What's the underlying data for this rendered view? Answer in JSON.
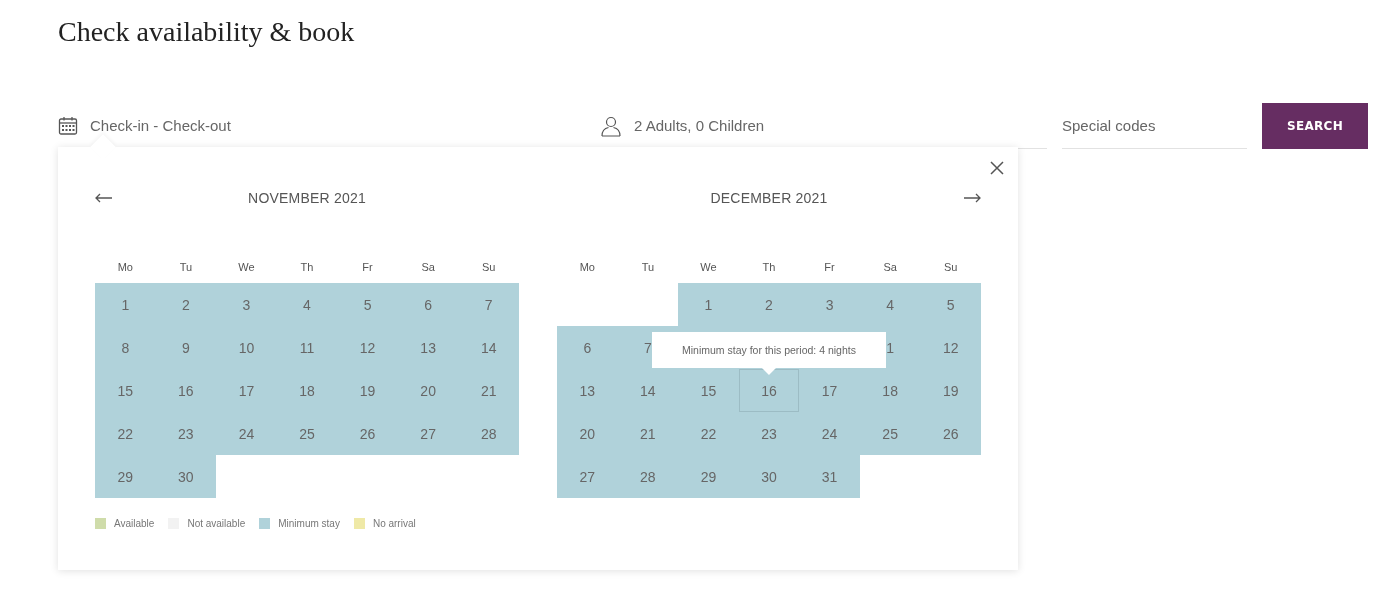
{
  "title": "Check availability & book",
  "search_bar": {
    "dates": {
      "placeholder": "Check-in - Check-out"
    },
    "guests": {
      "value": "2 Adults, 0 Children"
    },
    "special_codes": {
      "placeholder": "Special codes"
    },
    "search_button": "SEARCH"
  },
  "calendar": {
    "months": [
      {
        "title": "NOVEMBER 2021",
        "prev_arrow": true,
        "next_arrow": false,
        "weekdays": [
          "Mo",
          "Tu",
          "We",
          "Th",
          "Fr",
          "Sa",
          "Su"
        ],
        "days": [
          {
            "kind": "minimum_stay",
            "label": "1",
            "hovered": false
          },
          {
            "kind": "minimum_stay",
            "label": "2",
            "hovered": false
          },
          {
            "kind": "minimum_stay",
            "label": "3",
            "hovered": false
          },
          {
            "kind": "minimum_stay",
            "label": "4",
            "hovered": false
          },
          {
            "kind": "minimum_stay",
            "label": "5",
            "hovered": false
          },
          {
            "kind": "minimum_stay",
            "label": "6",
            "hovered": false
          },
          {
            "kind": "minimum_stay",
            "label": "7",
            "hovered": false
          },
          {
            "kind": "minimum_stay",
            "label": "8",
            "hovered": false
          },
          {
            "kind": "minimum_stay",
            "label": "9",
            "hovered": false
          },
          {
            "kind": "minimum_stay",
            "label": "10",
            "hovered": false
          },
          {
            "kind": "minimum_stay",
            "label": "11",
            "hovered": false
          },
          {
            "kind": "minimum_stay",
            "label": "12",
            "hovered": false
          },
          {
            "kind": "minimum_stay",
            "label": "13",
            "hovered": false
          },
          {
            "kind": "minimum_stay",
            "label": "14",
            "hovered": false
          },
          {
            "kind": "minimum_stay",
            "label": "15",
            "hovered": false
          },
          {
            "kind": "minimum_stay",
            "label": "16",
            "hovered": false
          },
          {
            "kind": "minimum_stay",
            "label": "17",
            "hovered": false
          },
          {
            "kind": "minimum_stay",
            "label": "18",
            "hovered": false
          },
          {
            "kind": "minimum_stay",
            "label": "19",
            "hovered": false
          },
          {
            "kind": "minimum_stay",
            "label": "20",
            "hovered": false
          },
          {
            "kind": "minimum_stay",
            "label": "21",
            "hovered": false
          },
          {
            "kind": "minimum_stay",
            "label": "22",
            "hovered": false
          },
          {
            "kind": "minimum_stay",
            "label": "23",
            "hovered": false
          },
          {
            "kind": "minimum_stay",
            "label": "24",
            "hovered": false
          },
          {
            "kind": "minimum_stay",
            "label": "25",
            "hovered": false
          },
          {
            "kind": "minimum_stay",
            "label": "26",
            "hovered": false
          },
          {
            "kind": "minimum_stay",
            "label": "27",
            "hovered": false
          },
          {
            "kind": "minimum_stay",
            "label": "28",
            "hovered": false
          },
          {
            "kind": "minimum_stay",
            "label": "29",
            "hovered": false
          },
          {
            "kind": "minimum_stay",
            "label": "30",
            "hovered": false
          }
        ]
      },
      {
        "title": "DECEMBER 2021",
        "prev_arrow": false,
        "next_arrow": true,
        "weekdays": [
          "Mo",
          "Tu",
          "We",
          "Th",
          "Fr",
          "Sa",
          "Su"
        ],
        "days": [
          {
            "kind": "blank"
          },
          {
            "kind": "blank"
          },
          {
            "kind": "minimum_stay",
            "label": "1",
            "hovered": false
          },
          {
            "kind": "minimum_stay",
            "label": "2",
            "hovered": false
          },
          {
            "kind": "minimum_stay",
            "label": "3",
            "hovered": false
          },
          {
            "kind": "minimum_stay",
            "label": "4",
            "hovered": false
          },
          {
            "kind": "minimum_stay",
            "label": "5",
            "hovered": false
          },
          {
            "kind": "minimum_stay",
            "label": "6",
            "hovered": false
          },
          {
            "kind": "minimum_stay",
            "label": "7",
            "hovered": false
          },
          {
            "kind": "covered"
          },
          {
            "kind": "covered"
          },
          {
            "kind": "covered"
          },
          {
            "kind": "minimum_stay",
            "label": "1",
            "hovered": false
          },
          {
            "kind": "minimum_stay",
            "label": "12",
            "hovered": false
          },
          {
            "kind": "minimum_stay",
            "label": "13",
            "hovered": false
          },
          {
            "kind": "minimum_stay",
            "label": "14",
            "hovered": false
          },
          {
            "kind": "minimum_stay",
            "label": "15",
            "hovered": false
          },
          {
            "kind": "minimum_stay",
            "label": "16",
            "hovered": true
          },
          {
            "kind": "minimum_stay",
            "label": "17",
            "hovered": false
          },
          {
            "kind": "minimum_stay",
            "label": "18",
            "hovered": false
          },
          {
            "kind": "minimum_stay",
            "label": "19",
            "hovered": false
          },
          {
            "kind": "minimum_stay",
            "label": "20",
            "hovered": false
          },
          {
            "kind": "minimum_stay",
            "label": "21",
            "hovered": false
          },
          {
            "kind": "minimum_stay",
            "label": "22",
            "hovered": false
          },
          {
            "kind": "minimum_stay",
            "label": "23",
            "hovered": false
          },
          {
            "kind": "minimum_stay",
            "label": "24",
            "hovered": false
          },
          {
            "kind": "minimum_stay",
            "label": "25",
            "hovered": false
          },
          {
            "kind": "minimum_stay",
            "label": "26",
            "hovered": false
          },
          {
            "kind": "minimum_stay",
            "label": "27",
            "hovered": false
          },
          {
            "kind": "minimum_stay",
            "label": "28",
            "hovered": false
          },
          {
            "kind": "minimum_stay",
            "label": "29",
            "hovered": false
          },
          {
            "kind": "minimum_stay",
            "label": "30",
            "hovered": false
          },
          {
            "kind": "minimum_stay",
            "label": "31",
            "hovered": false
          }
        ]
      }
    ],
    "tooltip": "Minimum stay for this period: 4 nights",
    "legend": [
      {
        "label": "Available",
        "color": "#cfdcaa"
      },
      {
        "label": "Not available",
        "color": "#f2f2f2"
      },
      {
        "label": "Minimum stay",
        "color": "#b0d2da"
      },
      {
        "label": "No arrival",
        "color": "#efe9a7"
      }
    ]
  }
}
